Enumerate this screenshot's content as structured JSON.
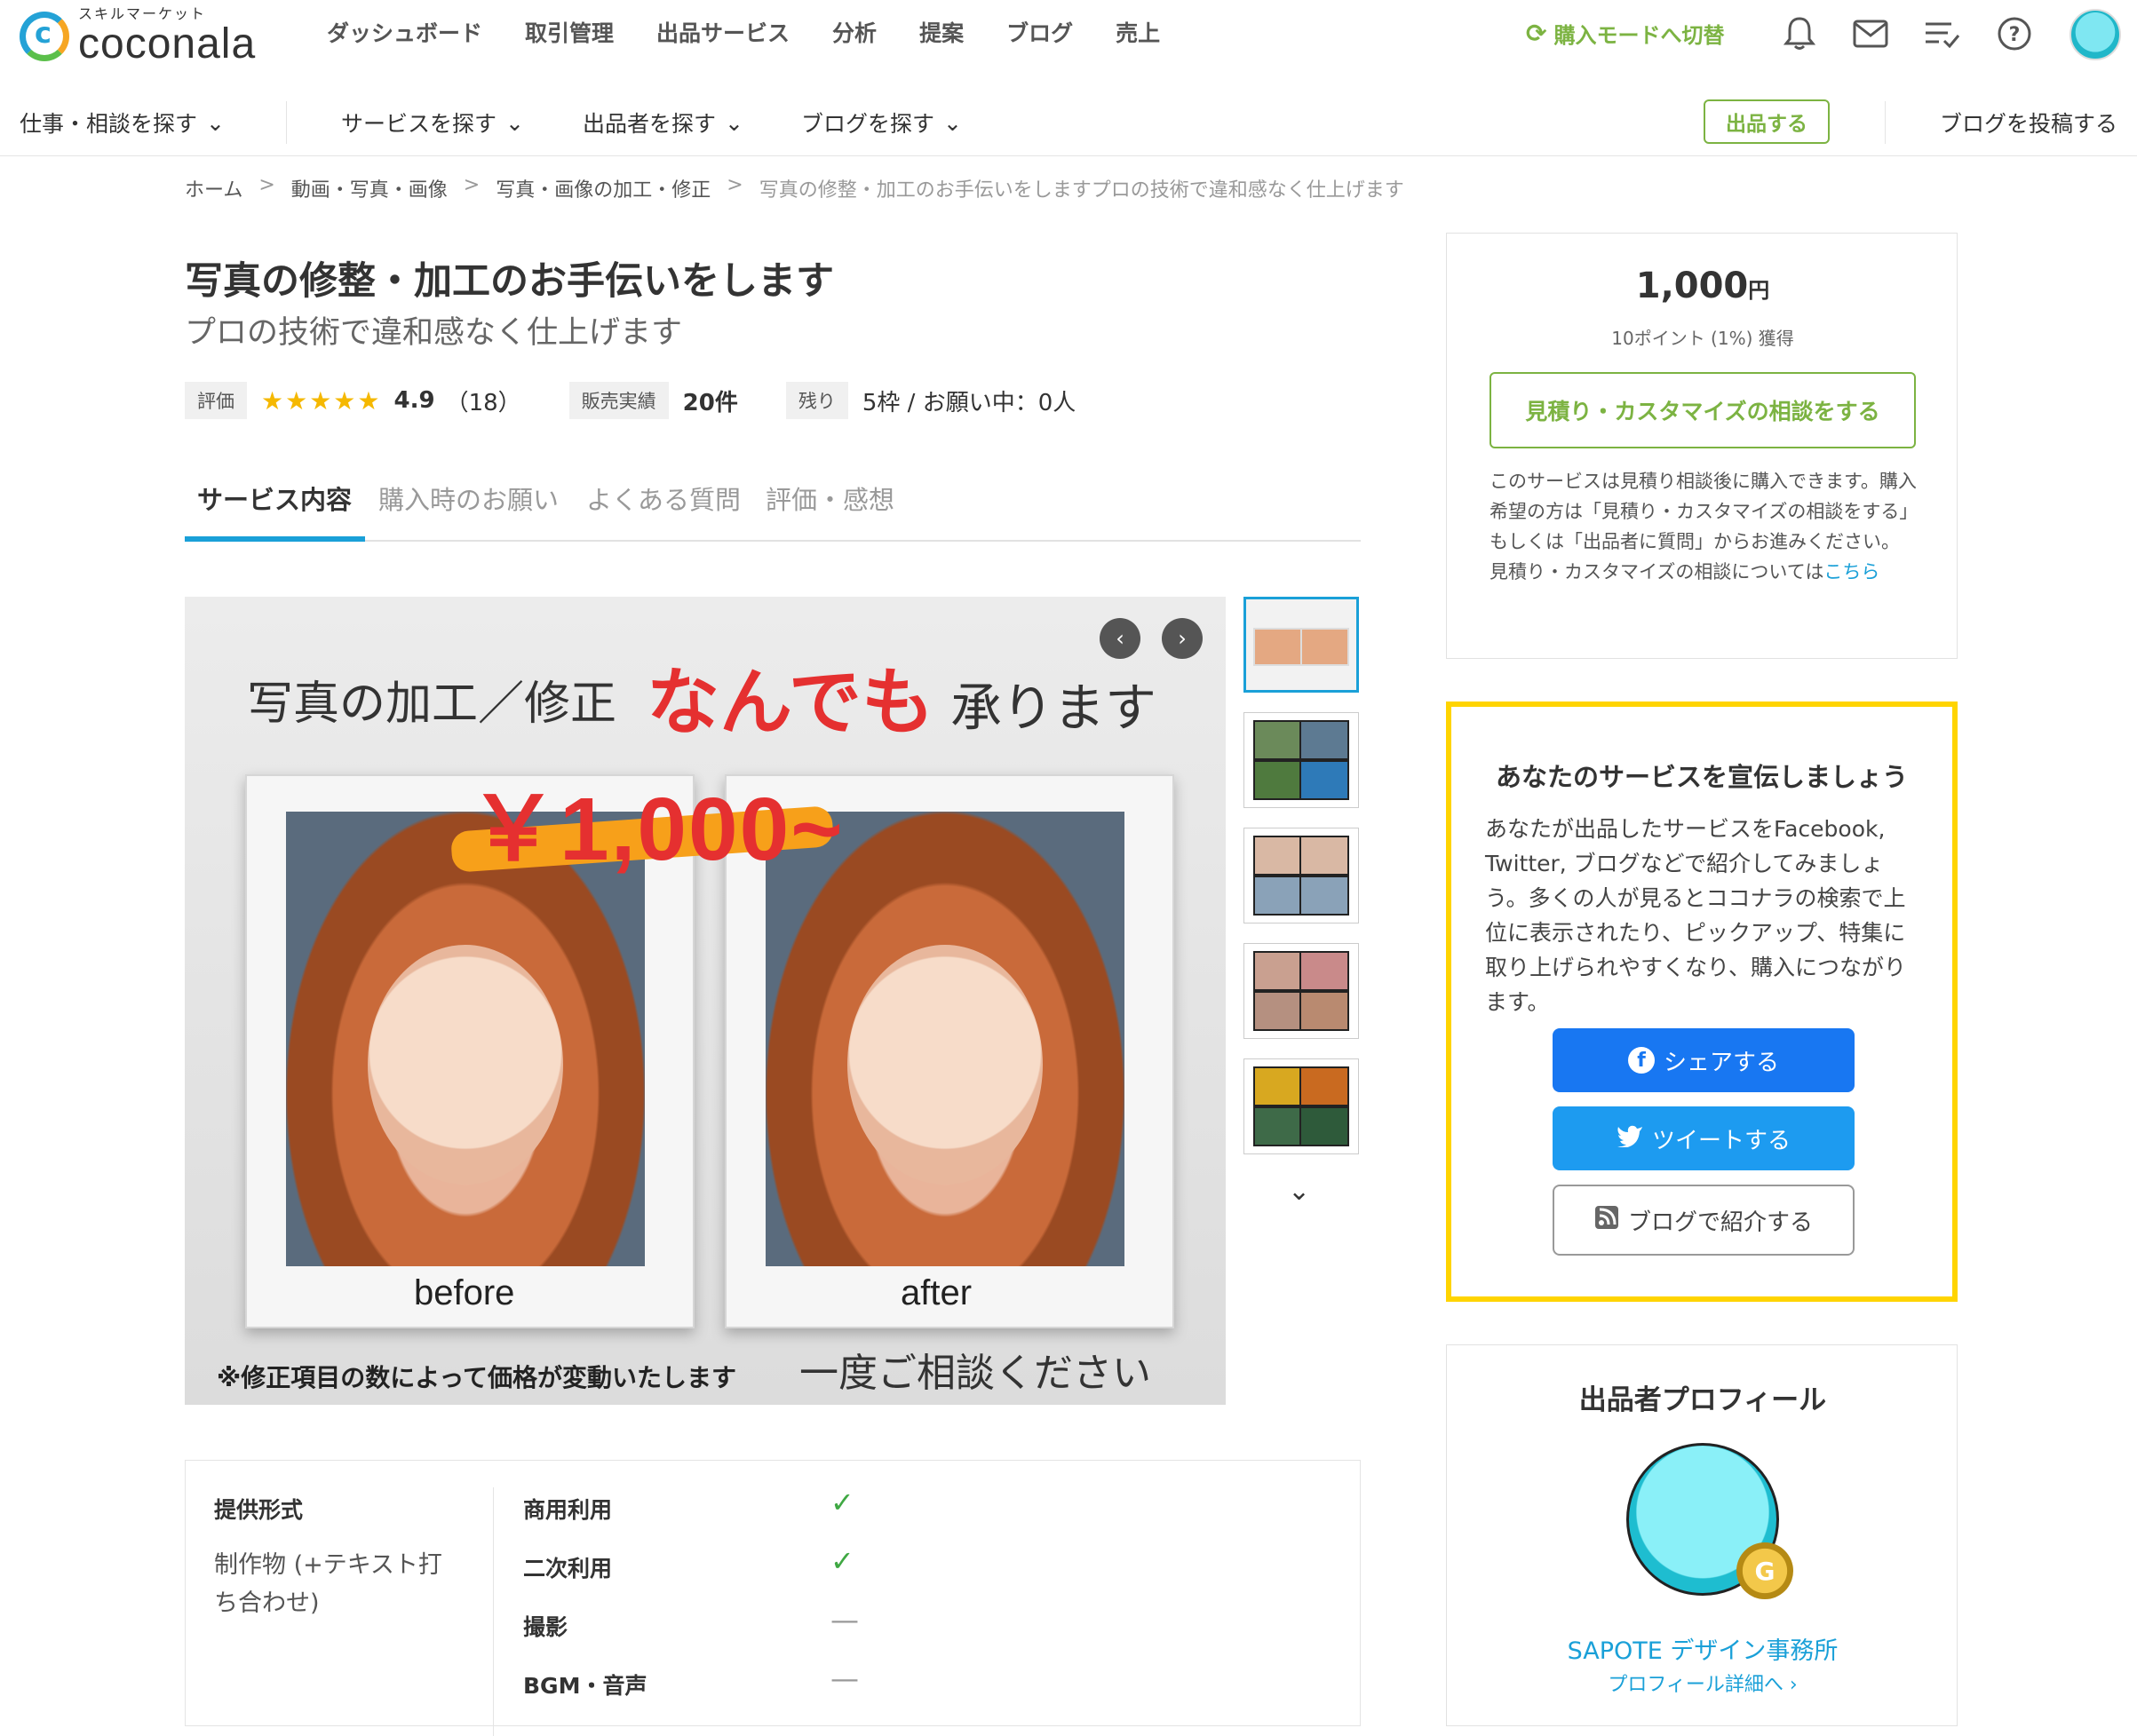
{
  "header": {
    "logo_small": "スキルマーケット",
    "logo": "coconala",
    "nav": [
      "ダッシュボード",
      "取引管理",
      "出品サービス",
      "分析",
      "提案",
      "ブログ",
      "売上"
    ],
    "switch_mode": "購入モードへ切替",
    "icons": [
      "bell-icon",
      "mail-icon",
      "list-icon",
      "help-icon"
    ]
  },
  "subnav": {
    "items": [
      "仕事・相談を探す",
      "サービスを探す",
      "出品者を探す",
      "ブログを探す"
    ],
    "post_button": "出品する",
    "blog_post": "ブログを投稿する"
  },
  "breadcrumb": [
    "ホーム",
    "動画・写真・画像",
    "写真・画像の加工・修正",
    "写真の修整・加工のお手伝いをしますプロの技術で違和感なく仕上げます"
  ],
  "service": {
    "title": "写真の修整・加工のお手伝いをします",
    "subtitle": "プロの技術で違和感なく仕上げます",
    "rating_label": "評価",
    "stars": "★★★★★",
    "rating": "4.9",
    "rating_count": "（18）",
    "sales_label": "販売実績",
    "sales": "20件",
    "remain_label": "残り",
    "remain": "5枠 / お願い中：0人"
  },
  "tabs": [
    "サービス内容",
    "購入時のお願い",
    "よくある質問",
    "評価・感想"
  ],
  "hero": {
    "head": "写真の加工／修正",
    "big": "なんでも",
    "tail": "承ります",
    "price": "￥1,000~",
    "before": "before",
    "after": "after",
    "note": "※修正項目の数によって価格が変動いたします",
    "note2": "一度ご相談ください"
  },
  "features": {
    "left_title": "提供形式",
    "left_value": "制作物 (+テキスト打ち合わせ)",
    "rows": [
      {
        "label": "商用利用",
        "mark": "✓"
      },
      {
        "label": "二次利用",
        "mark": "✓"
      },
      {
        "label": "撮影",
        "mark": "—"
      },
      {
        "label": "BGM・音声",
        "mark": "—"
      }
    ]
  },
  "price_card": {
    "price": "1,000",
    "unit": "円",
    "points": "10ポイント (1%) 獲得",
    "quote_button": "見積り・カスタマイズの相談をする",
    "note": "このサービスは見積り相談後に購入できます。購入希望の方は「見積り・カスタマイズの相談をする」もしくは「出品者に質問」からお進みください。",
    "note2": "見積り・カスタマイズの相談については",
    "note_link": "こちら"
  },
  "promo": {
    "title": "あなたのサービスを宣伝しましょう",
    "text": "あなたが出品したサービスをFacebook, Twitter, ブログなどで紹介してみましょう。多くの人が見るとココナラの検索で上位に表示されたり、ピックアップ、特集に取り上げられやすくなり、購入につながります。",
    "share": "シェアする",
    "tweet": "ツイートする",
    "blog": "ブログで紹介する"
  },
  "profile": {
    "title": "出品者プロフィール",
    "badge": "G",
    "name": "SAPOTE デザイン事務所",
    "link": "プロフィール詳細へ"
  }
}
